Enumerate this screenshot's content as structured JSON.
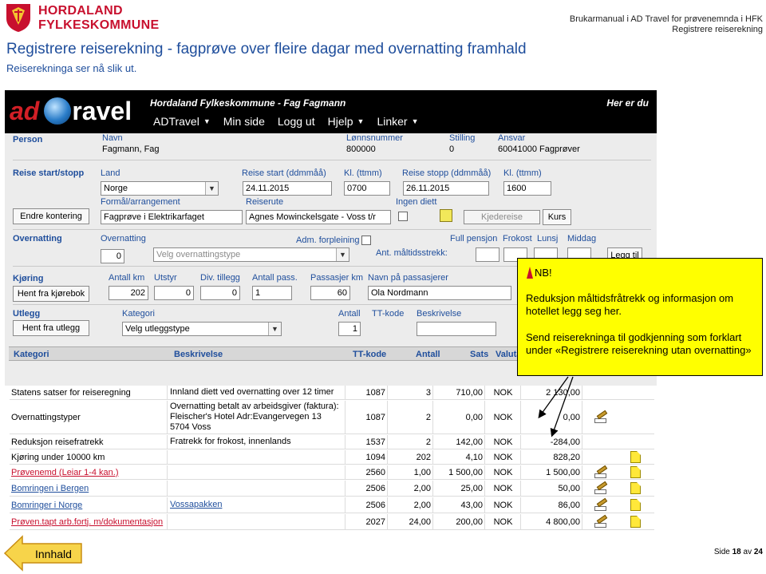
{
  "document": {
    "logo": {
      "line1": "HORDALAND",
      "line2": "FYLKESKOMMUNE"
    },
    "header_right": {
      "line1": "Brukarmanual i AD Travel for prøvenemnda i HFK",
      "line2": "Registrere reiserekning"
    },
    "title": "Registrere reiserekning - fagprøve over fleire dagar med overnatting framhald",
    "subtitle": "Reiserekninga ser nå slik ut.",
    "footer": {
      "nav_label": "Innhald",
      "page_prefix": "Side",
      "page_current": "18",
      "page_sep": "av",
      "page_total": "24"
    }
  },
  "app": {
    "brand_ad": "ad",
    "brand_travel": "ravel",
    "org_title": "Hordaland Fylkeskommune - Fag Fagmann",
    "right_link": "Her er du",
    "menu": [
      "ADTravel",
      "Min side",
      "Logg ut",
      "Hjelp",
      "Linker"
    ],
    "person": {
      "section": "Person",
      "name_label": "Navn",
      "name": "Fagmann, Fag",
      "lonn_label": "Lønnsnummer",
      "lonn": "800000",
      "stilling_label": "Stilling",
      "stilling": "0",
      "ansvar_label": "Ansvar",
      "ansvar": "60041000 Fagprøver"
    },
    "reise": {
      "section": "Reise start/stopp",
      "land_label": "Land",
      "land": "Norge",
      "start_label": "Reise start (ddmmåå)",
      "start": "24.11.2015",
      "kl_start_label": "Kl. (ttmm)",
      "kl_start": "0700",
      "stopp_label": "Reise stopp (ddmmåå)",
      "stopp": "26.11.2015",
      "kl_stopp_label": "Kl. (ttmm)",
      "kl_stopp": "1600",
      "endre_button": "Endre kontering",
      "formal_label": "Formål/arrangement",
      "formal": "Fagprøve i Elektrikarfaget",
      "rute_label": "Reiserute",
      "rute": "Agnes Mowinckelsgate - Voss t/r",
      "ingen_diett_label": "Ingen diett",
      "kjedereise_button": "Kjedereise",
      "kurs_button": "Kurs"
    },
    "overnatting": {
      "section": "Overnatting",
      "label": "Overnatting",
      "value": "0",
      "select": "Velg overnattingstype",
      "adm_label": "Adm. forpleining",
      "full_pensjon": "Full pensjon",
      "frokost": "Frokost",
      "lunsj": "Lunsj",
      "middag": "Middag",
      "ant_label": "Ant. måltidsstrekk:",
      "legg_til_button": "Legg til"
    },
    "kjoring": {
      "section": "Kjøring",
      "hent_button": "Hent fra kjørebok",
      "antall_km_label": "Antall km",
      "antall_km": "202",
      "utstyr_label": "Utstyr",
      "utstyr": "0",
      "div_label": "Div. tillegg",
      "div": "0",
      "pass_label": "Antall pass.",
      "pass": "1",
      "pass_km_label": "Passasjer km",
      "pass_km": "60",
      "navn_pass_label": "Navn på passasjerer",
      "navn_pass": "Ola Nordmann"
    },
    "utlegg": {
      "section": "Utlegg",
      "hent_button": "Hent fra utlegg",
      "kategori_label": "Kategori",
      "kategori": "Velg utleggstype",
      "antall_label": "Antall",
      "antall": "1",
      "tt_label": "TT-kode",
      "beskrivelse_label": "Beskrivelse"
    },
    "grid_headers": [
      "Kategori",
      "Beskrivelse",
      "TT-kode",
      "Antall",
      "Sats",
      "Valuta"
    ]
  },
  "table_rows": [
    {
      "kategori": "Statens satser for reiseregning",
      "link": false,
      "red": false,
      "beskrivelse": "Innland diett ved overnatting over 12 timer",
      "bes_link": false,
      "tt": "1087",
      "antall": "3",
      "sats": "710,00",
      "valuta": "NOK",
      "belop": "2 130,00",
      "edit": false,
      "note": false
    },
    {
      "kategori": "Overnattingstyper",
      "link": false,
      "red": false,
      "beskrivelse": "Overnatting betalt av arbeidsgiver (faktura): Fleischer's Hotel Adr:Evangervegen 13 5704 Voss",
      "bes_link": false,
      "tt": "1087",
      "antall": "2",
      "sats": "0,00",
      "valuta": "NOK",
      "belop": "0,00",
      "edit": true,
      "note": false
    },
    {
      "kategori": "Reduksjon reisefratrekk",
      "link": false,
      "red": false,
      "beskrivelse": "Fratrekk for frokost, innenlands",
      "bes_link": false,
      "tt": "1537",
      "antall": "2",
      "sats": "142,00",
      "valuta": "NOK",
      "belop": "-284,00",
      "edit": false,
      "note": false
    },
    {
      "kategori": "Kjøring under 10000 km",
      "link": false,
      "red": false,
      "beskrivelse": "",
      "bes_link": false,
      "tt": "1094",
      "antall": "202",
      "sats": "4,10",
      "valuta": "NOK",
      "belop": "828,20",
      "edit": false,
      "note": true
    },
    {
      "kategori": "Prøvenemd (Leiar 1-4 kan.)",
      "link": true,
      "red": true,
      "beskrivelse": "",
      "bes_link": false,
      "tt": "2560",
      "antall": "1,00",
      "sats": "1 500,00",
      "valuta": "NOK",
      "belop": "1 500,00",
      "edit": true,
      "note": true
    },
    {
      "kategori": "Bomringen i Bergen",
      "link": true,
      "red": false,
      "beskrivelse": "",
      "bes_link": false,
      "tt": "2506",
      "antall": "2,00",
      "sats": "25,00",
      "valuta": "NOK",
      "belop": "50,00",
      "edit": true,
      "note": true
    },
    {
      "kategori": "Bomringer i Norge",
      "link": true,
      "red": false,
      "beskrivelse": "Vossapakken",
      "bes_link": true,
      "tt": "2506",
      "antall": "2,00",
      "sats": "43,00",
      "valuta": "NOK",
      "belop": "86,00",
      "edit": true,
      "note": true
    },
    {
      "kategori": "Prøven.tapt arb.fortj. m/dokumentasjon",
      "link": true,
      "red": true,
      "beskrivelse": "",
      "bes_link": false,
      "tt": "2027",
      "antall": "24,00",
      "sats": "200,00",
      "valuta": "NOK",
      "belop": "4 800,00",
      "edit": true,
      "note": true
    }
  ],
  "callout": {
    "nb": "NB!",
    "p1": "Reduksjon måltidsfråtrekk og informasjon om hotellet legg seg her.",
    "p2": "Send reiserekninga til godkjenning som forklart under «Registrere reiserekning utan overnatting»"
  },
  "colors": {
    "accent": "#1f4e9c",
    "brand_red": "#c8102e",
    "callout": "#ffff00",
    "app_header": "#000000"
  }
}
